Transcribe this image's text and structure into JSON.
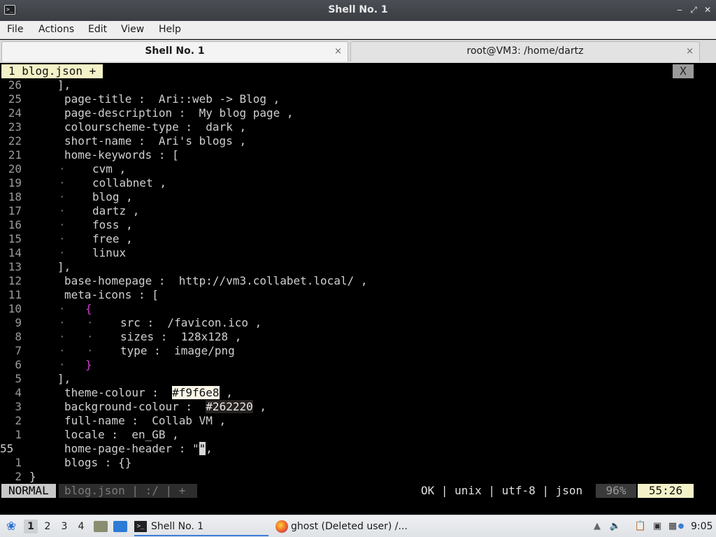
{
  "window": {
    "title": "Shell No. 1",
    "icon": "terminal-icon",
    "controls": {
      "minimize": "‒",
      "maximize": "⤢",
      "close": "✕"
    }
  },
  "menu": {
    "file": "File",
    "actions": "Actions",
    "edit": "Edit",
    "view": "View",
    "help": "Help"
  },
  "tabs": [
    {
      "label": "Shell No. 1",
      "close": "×"
    },
    {
      "label": "root@VM3: /home/dartz",
      "close": "×"
    }
  ],
  "editor": {
    "buffer_tab": "1 blog.json +",
    "buffer_close": "X",
    "lines": [
      {
        "num": "26",
        "indent": "  ",
        "text": "],"
      },
      {
        "num": "25",
        "indent": "   ",
        "text": "page-title :  Ari::web -> Blog ,"
      },
      {
        "num": "24",
        "indent": "   ",
        "text": "page-description :  My blog page ,"
      },
      {
        "num": "23",
        "indent": "   ",
        "text": "colourscheme-type :  dark ,"
      },
      {
        "num": "22",
        "indent": "   ",
        "text": "short-name :  Ari's blogs ,"
      },
      {
        "num": "21",
        "indent": "   ",
        "text": "home-keywords : ["
      },
      {
        "num": "20",
        "guide": "·",
        "text": "cvm ,"
      },
      {
        "num": "19",
        "guide": "·",
        "text": "collabnet ,"
      },
      {
        "num": "18",
        "guide": "·",
        "text": "blog ,"
      },
      {
        "num": "17",
        "guide": "·",
        "text": "dartz ,"
      },
      {
        "num": "16",
        "guide": "·",
        "text": "foss ,"
      },
      {
        "num": "15",
        "guide": "·",
        "text": "free ,"
      },
      {
        "num": "14",
        "guide": "·",
        "text": "linux"
      },
      {
        "num": "13",
        "indent": "  ",
        "text": "],"
      },
      {
        "num": "12",
        "indent": "   ",
        "text": "base-homepage :  http://vm3.collabet.local/ ,"
      },
      {
        "num": "11",
        "indent": "   ",
        "text": "meta-icons : ["
      },
      {
        "num": "10",
        "guide": "·",
        "text": "{"
      },
      {
        "num": "9",
        "guide": "·",
        "guide2": "·",
        "text": "src :  /favicon.ico ,"
      },
      {
        "num": "8",
        "guide": "·",
        "guide2": "·",
        "text": "sizes :  128x128 ,"
      },
      {
        "num": "7",
        "guide": "·",
        "guide2": "·",
        "text": "type :  image/png"
      },
      {
        "num": "6",
        "guide": "·",
        "text": "}"
      },
      {
        "num": "5",
        "indent": "  ",
        "text": "],"
      },
      {
        "num": "4",
        "indent": "   ",
        "text": "theme-colour :  #f9f6e8 ,"
      },
      {
        "num": "3",
        "indent": "   ",
        "text": "background-colour :  #262220 ,"
      },
      {
        "num": "2",
        "indent": "   ",
        "text": "full-name :  Collab VM ,"
      },
      {
        "num": "1",
        "indent": "   ",
        "text": "locale :  en_GB ,"
      },
      {
        "num": "55",
        "indent": "   ",
        "text": "home-page-header : \"\","
      },
      {
        "num": "1",
        "indent": "   ",
        "text": "blogs : {}"
      },
      {
        "num": "2",
        "indent": "",
        "text": "}"
      }
    ],
    "colors": {
      "theme": "#f9f6e8",
      "background": "#262220"
    }
  },
  "statusline": {
    "mode": "NORMAL",
    "file": "blog.json | :/ | +",
    "info": "OK | unix | utf-8 | json",
    "percent": "96%",
    "position": "55:26"
  },
  "taskbar": {
    "start_icon": "start-menu-icon",
    "workspaces": [
      "1",
      "2",
      "3",
      "4"
    ],
    "tasks": [
      {
        "label": "Shell No. 1",
        "icon": "terminal-icon"
      },
      {
        "label": "ghost (Deleted user) /...",
        "icon": "firefox-icon"
      }
    ],
    "clock": "9:05"
  }
}
